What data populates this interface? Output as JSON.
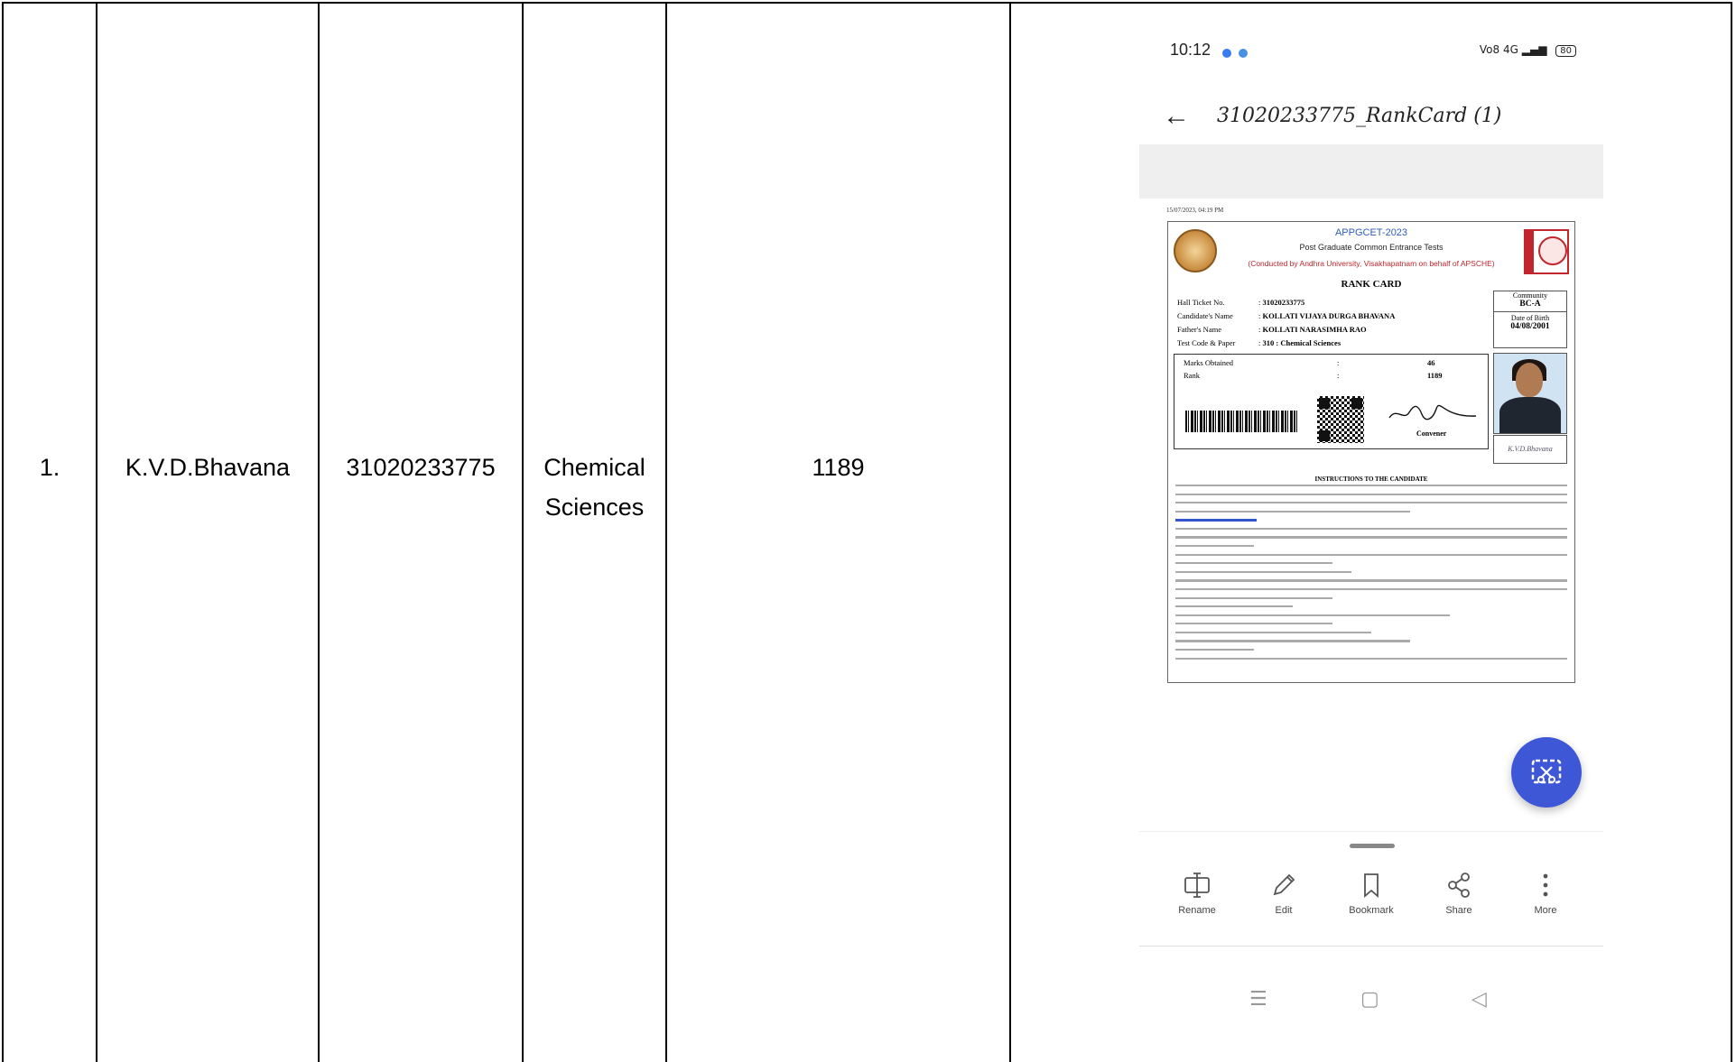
{
  "table": {
    "sno": "1.",
    "name": "K.V.D.Bhavana",
    "hall_ticket": "31020233775",
    "subject_line1": "Chemical",
    "subject_line2": "Sciences",
    "rank": "1189"
  },
  "phone": {
    "status_time": "10:12",
    "status_right": "Vo8 4G",
    "battery": "80",
    "doc_title": "31020233775_RankCard (1)",
    "rank_card": {
      "date_time": "15/07/2023, 04:19 PM",
      "header1": "APPGCET-2023",
      "header2": "Post Graduate Common Entrance Tests",
      "header3": "(Conducted by Andhra University, Visakhapatnam on behalf of APSCHE)",
      "title": "RANK CARD",
      "fields": [
        {
          "label": "Hall Ticket No.",
          "value": "31020233775"
        },
        {
          "label": "Candidate's Name",
          "value": "KOLLATI VIJAYA DURGA BHAVANA"
        },
        {
          "label": "Father's Name",
          "value": "KOLLATI NARASIMHA RAO"
        },
        {
          "label": "Test Code & Paper",
          "value": "310 : Chemical Sciences"
        }
      ],
      "community_label": "Community",
      "community_value": "BC-A",
      "dob_label": "Date of Birth",
      "dob_value": "04/08/2001",
      "marks_label": "Marks Obtained",
      "marks_value": "46",
      "rank_label": "Rank",
      "rank_value": "1189",
      "convener": "Convener",
      "signature_text": "K.V.D.Bhavana",
      "instructions_title": "INSTRUCTIONS TO THE CANDIDATE"
    },
    "actions": [
      {
        "label": "Rename",
        "icon": "rename-icon"
      },
      {
        "label": "Edit",
        "icon": "pencil-icon"
      },
      {
        "label": "Bookmark",
        "icon": "bookmark-icon"
      },
      {
        "label": "Share",
        "icon": "share-icon"
      },
      {
        "label": "More",
        "icon": "more-vertical-icon"
      }
    ],
    "fab_icon": "scan-screenshot-icon",
    "accent_color": "#3e57d6"
  }
}
